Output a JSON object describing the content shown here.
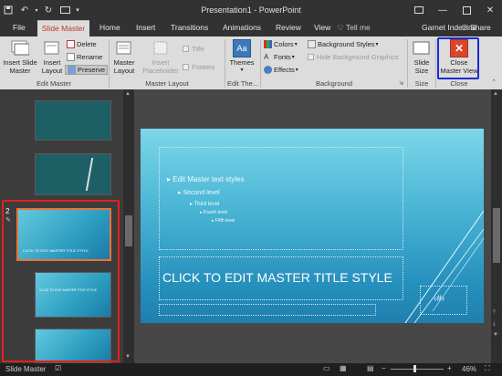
{
  "window": {
    "title": "Presentation1 - PowerPoint",
    "user": "Garnet Indezine",
    "share": "Share",
    "tell_me": "Tell me"
  },
  "tabs": [
    {
      "label": "File"
    },
    {
      "label": "Slide Master"
    },
    {
      "label": "Home"
    },
    {
      "label": "Insert"
    },
    {
      "label": "Transitions"
    },
    {
      "label": "Animations"
    },
    {
      "label": "Review"
    },
    {
      "label": "View"
    }
  ],
  "ribbon": {
    "edit_master": {
      "label": "Edit Master",
      "insert_slide_master": "Insert Slide Master",
      "insert_layout": "Insert Layout",
      "delete": "Delete",
      "rename": "Rename",
      "preserve": "Preserve"
    },
    "master_layout": {
      "label": "Master Layout",
      "master_layout_btn": "Master Layout",
      "insert_placeholder": "Insert Placeholder",
      "title": "Title",
      "footers": "Footers"
    },
    "edit_theme": {
      "label": "Edit The...",
      "themes": "Themes"
    },
    "background": {
      "label": "Background",
      "colors": "Colors",
      "fonts": "Fonts",
      "effects": "Effects",
      "background_styles": "Background Styles",
      "hide_background_graphics": "Hide Background Graphics"
    },
    "size": {
      "label": "Size",
      "slide_size": "Slide Size"
    },
    "close": {
      "label": "Close",
      "close_master_view": "Close Master View"
    }
  },
  "slide_panel": {
    "selected_number": "2",
    "layout_thumb_title": "CLICK TO EDIT MASTER TITLE STYLE",
    "layout_thumb_title2": "CLICK TO EDIT MASTER TITLE STYLE"
  },
  "slide": {
    "levels": [
      "Edit Master text styles",
      "Second level",
      "Third level",
      "Fourth level",
      "Fifth level"
    ],
    "title": "CLICK TO EDIT MASTER TITLE STYLE",
    "page_number": "‹#›"
  },
  "statusbar": {
    "mode": "Slide Master",
    "zoom": "46%"
  },
  "colors": {
    "accent_red": "#e3201b",
    "highlight_blue": "#1a2bd4",
    "ribbon_bg": "#dcdcdc",
    "dark_bg": "#2b2b2b"
  }
}
